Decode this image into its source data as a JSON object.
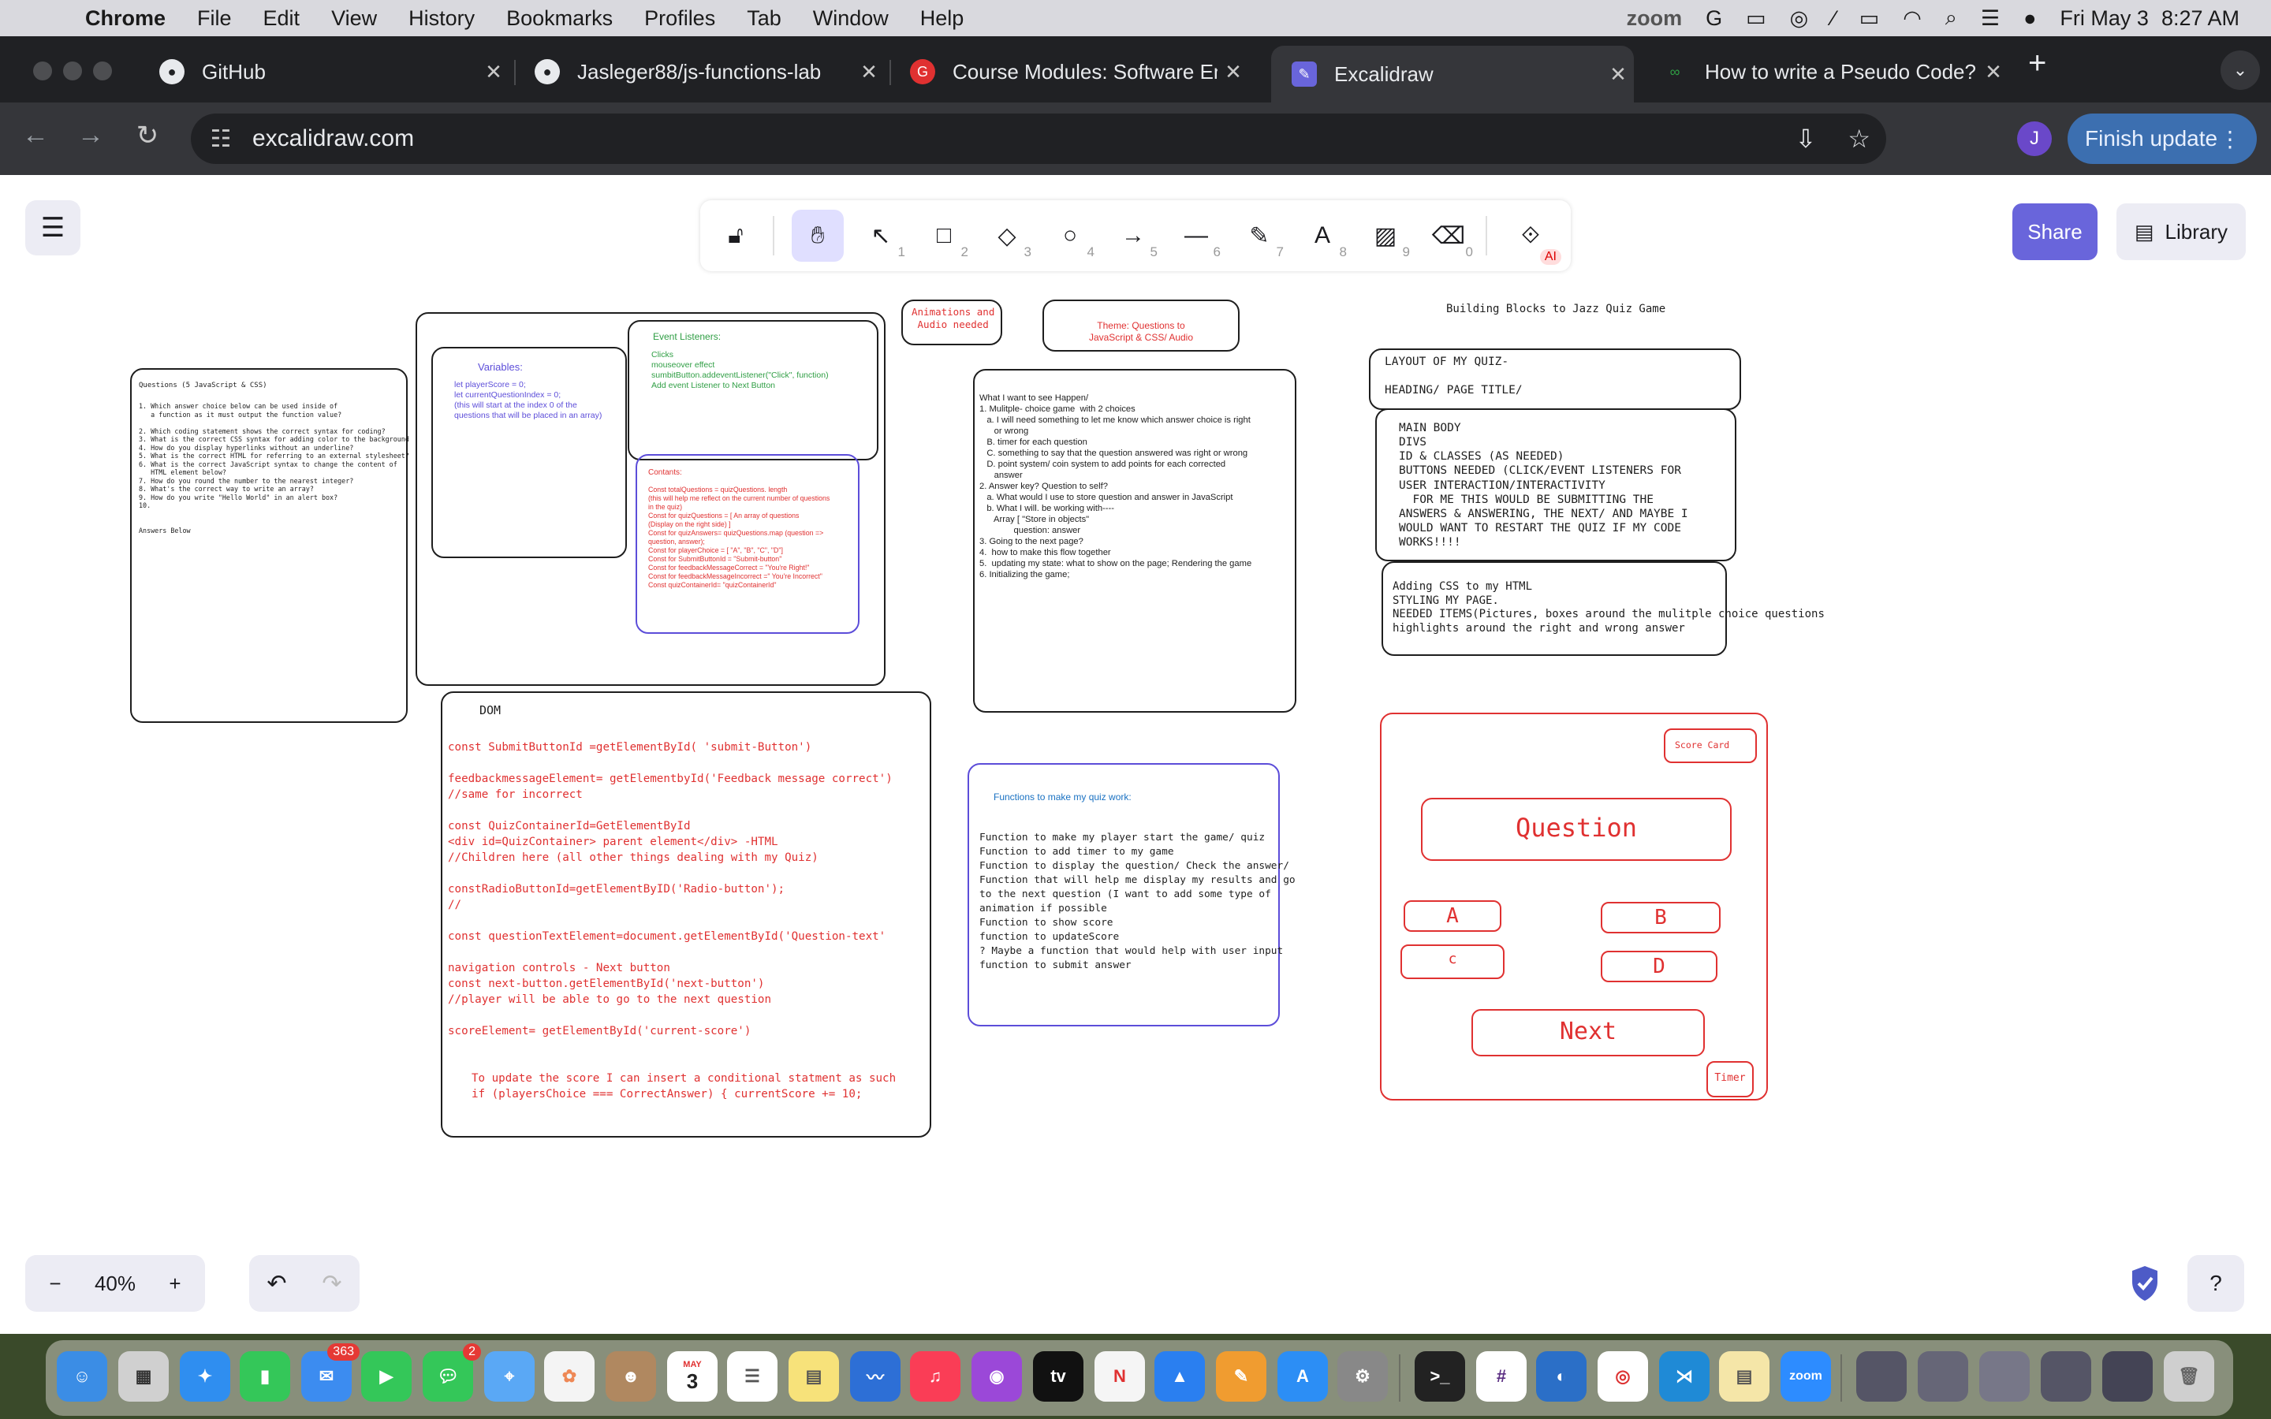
{
  "menubar": {
    "app": "Chrome",
    "items": [
      "File",
      "Edit",
      "View",
      "History",
      "Bookmarks",
      "Profiles",
      "Tab",
      "Window",
      "Help"
    ],
    "right": {
      "zoom_label": "zoom",
      "date": "Fri May 3",
      "time": "8:27 AM"
    }
  },
  "tabs": [
    {
      "title": "GitHub",
      "icon": "github-icon"
    },
    {
      "title": "Jasleger88/js-functions-lab",
      "icon": "github-icon"
    },
    {
      "title": "Course Modules: Software En",
      "icon": "ga-icon"
    },
    {
      "title": "Excalidraw",
      "icon": "excalidraw-icon",
      "active": true
    },
    {
      "title": "How to write a Pseudo Code?",
      "icon": "gfg-icon"
    }
  ],
  "address": {
    "url": "excalidraw.com"
  },
  "profile_initial": "J",
  "finish_update_label": "Finish update",
  "excalidraw": {
    "tools": [
      {
        "name": "lock",
        "key": ""
      },
      {
        "name": "hand",
        "key": ""
      },
      {
        "name": "selection",
        "key": "1"
      },
      {
        "name": "rectangle",
        "key": "2"
      },
      {
        "name": "diamond",
        "key": "3"
      },
      {
        "name": "ellipse",
        "key": "4"
      },
      {
        "name": "arrow",
        "key": "5"
      },
      {
        "name": "line",
        "key": "6"
      },
      {
        "name": "draw",
        "key": "7"
      },
      {
        "name": "text",
        "key": "8"
      },
      {
        "name": "image",
        "key": "9"
      },
      {
        "name": "eraser",
        "key": "0"
      },
      {
        "name": "more-tools",
        "key": "AI"
      }
    ],
    "share_label": "Share",
    "library_label": "Library",
    "zoom_level": "40%"
  },
  "canvas": {
    "questions_title": "Questions (5 JavaScript & CSS)",
    "questions_body": "1. Which answer choice below can be used inside of\n   a function as it must output the function value?\n\n2. Which coding statement shows the correct syntax for coding?\n3. What is the correct CSS syntax for adding color to the background\n4. How do you display hyperlinks without an underline?\n5. What is the correct HTML for referring to an external stylesheet?\n6. What is the correct JavaScript syntax to change the content of\n   HTML element below?\n7. How do you round the number to the nearest integer?\n8. What's the correct way to write an array?\n9. How do you write \"Hello World\" in an alert box?\n10.\n\n\nAnswers Below",
    "variables_title": "Variables:",
    "variables_body": "let playerScore = 0;\nlet currentQuestionIndex = 0;\n(this will start at the index 0 of the\nquestions that will be placed in an array)",
    "event_title": "Event Listeners:",
    "event_body": "Clicks\nmouseover effect\nsumbitButton.addeventListener(\"Click\", function)\nAdd event Listener to Next Button",
    "constants_title": "Contants:",
    "constants_body": "Const totalQuestions = quizQuestions. length\n(this will help me reflect on the current number of questions\nin the quiz)\nConst for quizQuestions = [ An array of questions\n(Display on the right side) ]\nConst for quizAnswers= quizQuestions.map (question =>\nquestion, answer);\nConst for playerChoice = [ \"A\", \"B\", \"C\", \"D\"]\nConst for SubmitButtonId = \"Submit-button\"\nConst for feedbackMessageCorrect = \"You're Right!\"\nConst for feedbackMessageIncorrect =\" You're Incorrect\"\nConst quizContainerId= \"quizContainerId\"",
    "animations_note": "Animations and\nAudio needed",
    "theme_note": "Theme: Questions to\nJavaScript & CSS/ Audio",
    "want_body": "What I want to see Happen/\n1. Mulitple- choice game  with 2 choices\n   a. I will need something to let me know which answer choice is right\n      or wrong\n   B. timer for each question\n   C. something to say that the question answered was right or wrong\n   D. point system/ coin system to add points for each corrected\n      answer\n2. Answer key? Question to self?\n   a. What would I use to store question and answer in JavaScript\n   b. What I will. be working with----\n      Array [ \"Store in objects\"\n              question: answer\n3. Going to the next page?\n4.  how to make this flow together\n5.  updating my state: what to show on the page; Rendering the game\n6. Initializing the game;",
    "building_title": "Building Blocks to Jazz Quiz Game",
    "layout_body": "LAYOUT OF MY QUIZ-\n\nHEADING/ PAGE TITLE/",
    "main_body": "MAIN BODY\nDIVS\nID & CLASSES (AS NEEDED)\nBUTTONS NEEDED (CLICK/EVENT LISTENERS FOR\nUSER INTERACTION/INTERACTIVITY\n  FOR ME THIS WOULD BE SUBMITTING THE\nANSWERS & ANSWERING, THE NEXT/ AND MAYBE I\nWOULD WANT TO RESTART THE QUIZ IF MY CODE\nWORKS!!!!",
    "css_body": "Adding CSS to my HTML\nSTYLING MY PAGE.\nNEEDED ITEMS(Pictures, boxes around the mulitple choice questions\nhighlights around the right and wrong answer",
    "dom_title": "DOM",
    "dom_body": "const SubmitButtonId =getElementById( 'submit-Button')\n\nfeedbackmessageElement= getElementbyId('Feedback message correct')\n//same for incorrect\n\nconst QuizContainerId=GetElementById\n<div id=QuizContainer> parent element</div> -HTML\n//Children here (all other things dealing with my Quiz)\n\nconstRadioButtonId=getElementByID('Radio-button');\n//\n\nconst questionTextElement=document.getElementById('Question-text'\n\nnavigation controls - Next button\nconst next-button.getElementById('next-button')\n//player will be able to go to the next question\n\nscoreElement= getElementById('current-score')",
    "dom_note": "To update the score I can insert a conditional statment as such\nif (playersChoice === CorrectAnswer) { currentScore += 10;",
    "functions_title": "Functions to make my quiz work:",
    "functions_body": "Function to make my player start the game/ quiz\nFunction to add timer to my game\nFunction to display the question/ Check the answer/\nFunction that will help me display my results and go\nto the next question (I want to add some type of\nanimation if possible\nFunction to show score\nfunction to updateScore\n? Maybe a function that would help with user input\nfunction to submit answer",
    "mock_score": "Score Card",
    "mock_question": "Question",
    "mock_a": "A",
    "mock_b": "B",
    "mock_c": "c",
    "mock_d": "D",
    "mock_next": "Next",
    "mock_timer": "Timer"
  },
  "dock": {
    "mail_badge": "363",
    "messages_badge": "2",
    "calendar_month": "MAY",
    "calendar_day": "3",
    "tv_label": "tv",
    "zoom_label": "zoom"
  }
}
